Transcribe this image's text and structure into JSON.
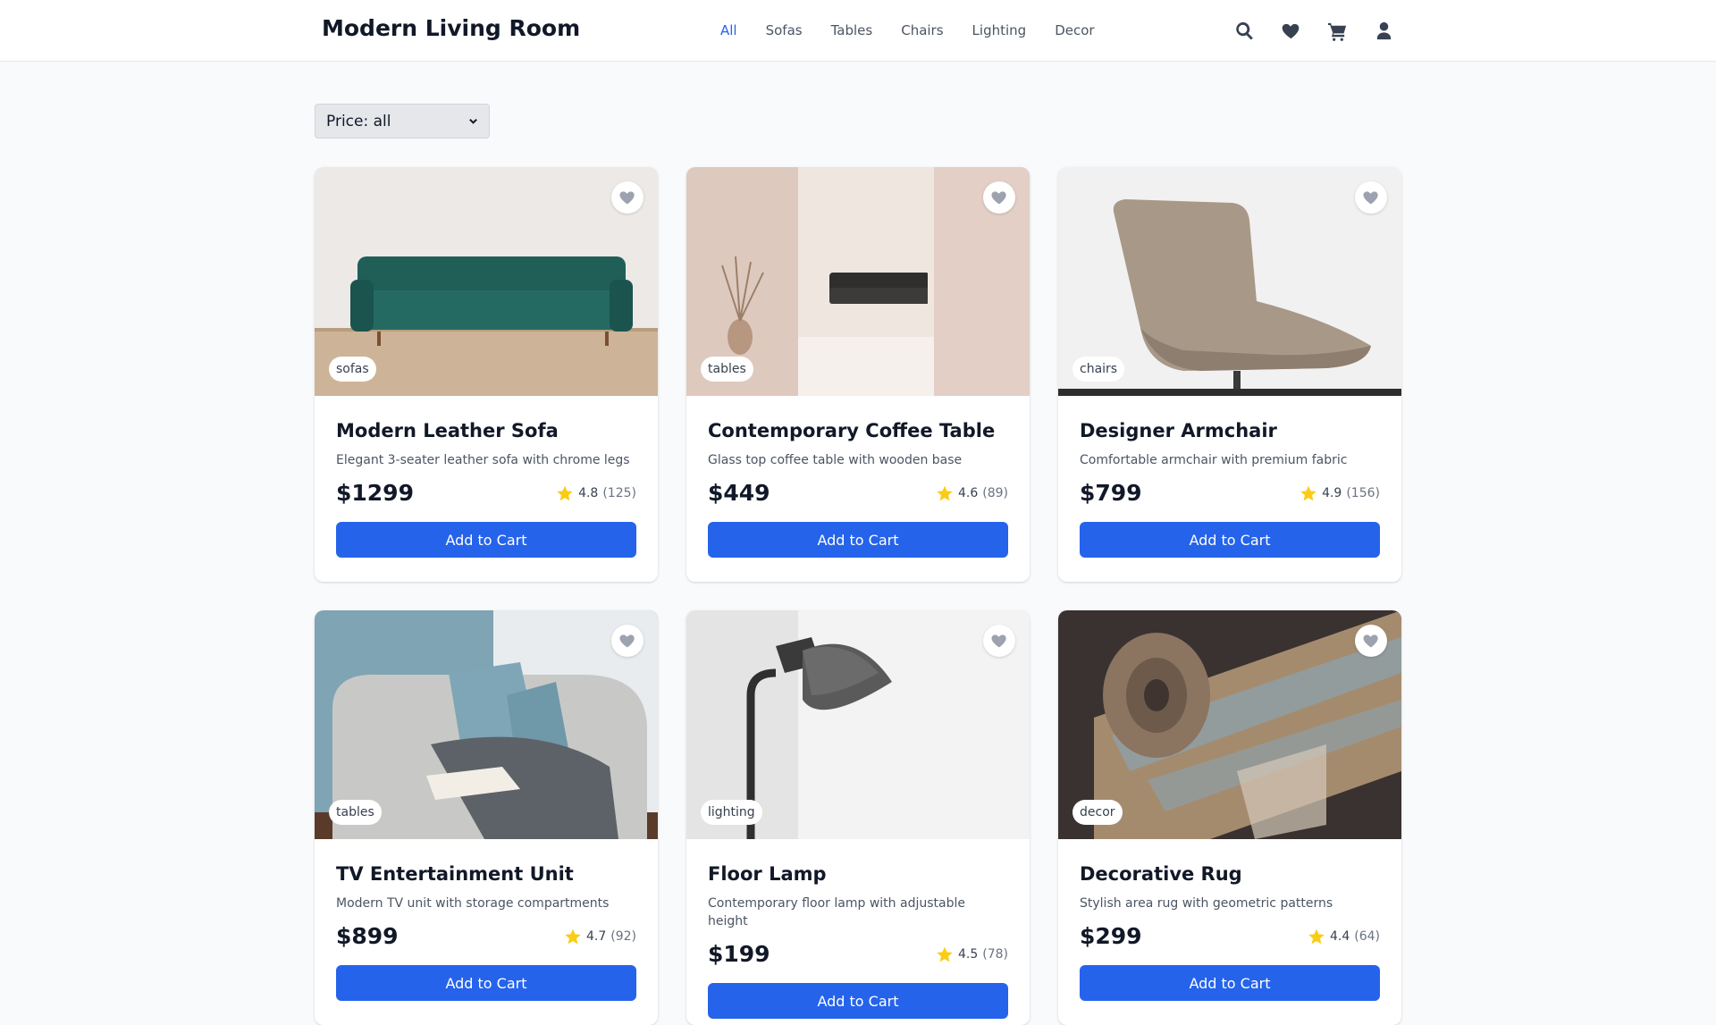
{
  "header": {
    "title": "Modern Living Room",
    "nav": [
      "All",
      "Sofas",
      "Tables",
      "Chairs",
      "Lighting",
      "Decor"
    ],
    "active_nav": "All",
    "icons": [
      "search-icon",
      "heart-icon",
      "cart-icon",
      "user-icon"
    ]
  },
  "filter": {
    "selected": "Price: all"
  },
  "colors": {
    "accent": "#2563eb",
    "star": "#facc15",
    "favorite_inactive": "#9ca3af",
    "page_background": "#f9fafb"
  },
  "products": [
    {
      "name": "Modern Leather Sofa",
      "description": "Elegant 3-seater leather sofa with chrome legs",
      "price": "$1299",
      "rating": "4.8",
      "reviews": "(125)",
      "category": "sofas",
      "cta": "Add to Cart"
    },
    {
      "name": "Contemporary Coffee Table",
      "description": "Glass top coffee table with wooden base",
      "price": "$449",
      "rating": "4.6",
      "reviews": "(89)",
      "category": "tables",
      "cta": "Add to Cart"
    },
    {
      "name": "Designer Armchair",
      "description": "Comfortable armchair with premium fabric",
      "price": "$799",
      "rating": "4.9",
      "reviews": "(156)",
      "category": "chairs",
      "cta": "Add to Cart"
    },
    {
      "name": "TV Entertainment Unit",
      "description": "Modern TV unit with storage compartments",
      "price": "$899",
      "rating": "4.7",
      "reviews": "(92)",
      "category": "tables",
      "cta": "Add to Cart"
    },
    {
      "name": "Floor Lamp",
      "description": "Contemporary floor lamp with adjustable height",
      "price": "$199",
      "rating": "4.5",
      "reviews": "(78)",
      "category": "lighting",
      "cta": "Add to Cart"
    },
    {
      "name": "Decorative Rug",
      "description": "Stylish area rug with geometric patterns",
      "price": "$299",
      "rating": "4.4",
      "reviews": "(64)",
      "category": "decor",
      "cta": "Add to Cart"
    }
  ]
}
